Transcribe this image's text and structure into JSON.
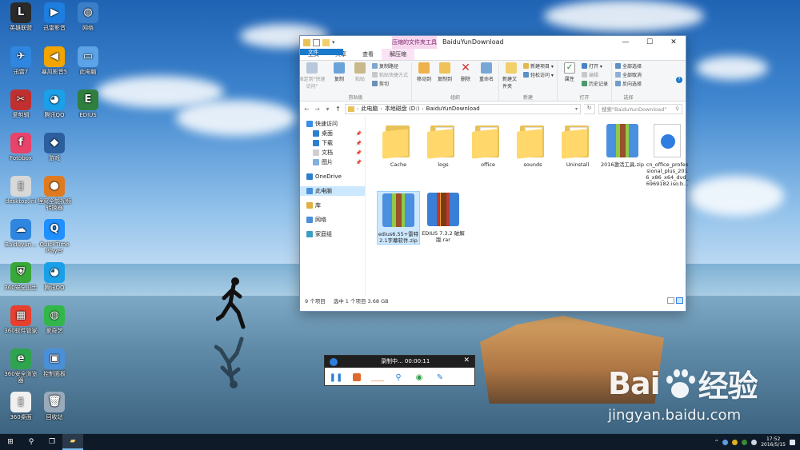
{
  "desktop": {
    "icons": [
      {
        "label": "英雄联盟",
        "color": "#2a2a2a",
        "glyph": "L"
      },
      {
        "label": "迅雷影音",
        "color": "#1d7ee0",
        "glyph": "▶"
      },
      {
        "label": "网络",
        "color": "#3a7fc8",
        "glyph": "◍"
      },
      {
        "label": "迅雷7",
        "color": "#2f86e0",
        "glyph": "✈"
      },
      {
        "label": "暴风影音5",
        "color": "#f2a500",
        "glyph": "◀"
      },
      {
        "label": "此电脑",
        "color": "#5ba3e6",
        "glyph": "▭"
      },
      {
        "label": "爱剪辑",
        "color": "#c03030",
        "glyph": "✂"
      },
      {
        "label": "腾讯QQ",
        "color": "#1aa0e8",
        "glyph": "◕"
      },
      {
        "label": "EDIUS",
        "color": "#2f7f3f",
        "glyph": "E"
      },
      {
        "label": "Fotobox",
        "color": "#e8436a",
        "glyph": "f"
      },
      {
        "label": "游戏",
        "color": "#2b5f9e",
        "glyph": "◆"
      },
      {
        "label": "desktop.ini",
        "color": "#d8d8d8",
        "glyph": "▯"
      },
      {
        "label": "狸窝全能视频转换器",
        "color": "#e07a20",
        "glyph": "●"
      },
      {
        "label": "Baiduyun...",
        "color": "#2f86e0",
        "glyph": "☁"
      },
      {
        "label": "QuickTime Player",
        "color": "#1e90ff",
        "glyph": "Q"
      },
      {
        "label": "360安全卫士",
        "color": "#38a838",
        "glyph": "⛨"
      },
      {
        "label": "腾讯QQ",
        "color": "#1aa0e8",
        "glyph": "◕"
      },
      {
        "label": "360软件管家",
        "color": "#e84030",
        "glyph": "▦"
      },
      {
        "label": "爱奇艺",
        "color": "#33b74a",
        "glyph": "◍"
      },
      {
        "label": "360安全浏览器",
        "color": "#2ea44f",
        "glyph": "e"
      },
      {
        "label": "控制面板",
        "color": "#4a90d9",
        "glyph": "▣"
      },
      {
        "label": "360桌面",
        "color": "#f0f0f0",
        "glyph": "▯"
      },
      {
        "label": "回收站",
        "color": "#9ab",
        "glyph": "🗑"
      }
    ]
  },
  "window": {
    "title": "BaiduYunDownload",
    "context_tab": "压缩的文件夹工具",
    "controls": {
      "minimize": "—",
      "maximize": "☐",
      "close": "✕"
    },
    "tabs": [
      "文件",
      "主页",
      "共享",
      "查看",
      "解压缩"
    ],
    "ribbon": {
      "clipboard": {
        "label": "剪贴板",
        "pin": "固定到\"快速访问\"",
        "copy": "复制",
        "paste": "粘贴",
        "small": [
          "复制路径",
          "粘贴快捷方式",
          "剪切"
        ]
      },
      "organize": {
        "label": "组织",
        "move_to": "移动到",
        "copy_to": "复制到",
        "delete": "删除",
        "rename": "重命名"
      },
      "new": {
        "label": "新建",
        "new_folder": "新建文件夹",
        "small": [
          "新建项目 ▾",
          "轻松访问 ▾"
        ]
      },
      "open": {
        "label": "打开",
        "properties": "属性",
        "small": [
          "打开 ▾",
          "编辑",
          "历史记录"
        ]
      },
      "select": {
        "label": "选择",
        "small": [
          "全部选择",
          "全部取消",
          "反向选择"
        ]
      },
      "help": "?"
    },
    "nav": {
      "back": "←",
      "forward": "→",
      "up": "↑",
      "recent": "▾",
      "refresh": "↻"
    },
    "address": [
      "此电脑",
      "本地磁盘 (D:)",
      "BaiduYunDownload"
    ],
    "search_placeholder": "搜索\"BaiduYunDownload\"",
    "navpane": [
      {
        "label": "快速访问",
        "type": "top",
        "color": "#3a8ee6"
      },
      {
        "label": "桌面",
        "type": "sub",
        "color": "#2f7fcf",
        "pin": "📌"
      },
      {
        "label": "下载",
        "type": "sub",
        "color": "#2f7fcf",
        "pin": "📌"
      },
      {
        "label": "文档",
        "type": "sub",
        "color": "#cfcfcf",
        "pin": "📌"
      },
      {
        "label": "图片",
        "type": "sub",
        "color": "#7fb0e0",
        "pin": "📌"
      },
      {
        "label": "OneDrive",
        "type": "top",
        "color": "#2f7fcf"
      },
      {
        "label": "此电脑",
        "type": "top",
        "color": "#4a90d9",
        "selected": true
      },
      {
        "label": "库",
        "type": "top",
        "color": "#e0b040"
      },
      {
        "label": "网络",
        "type": "top",
        "color": "#4a90d9"
      },
      {
        "label": "家庭组",
        "type": "top",
        "color": "#3aa0c0"
      }
    ],
    "files": [
      {
        "name": "Cache",
        "kind": "folder"
      },
      {
        "name": "logs",
        "kind": "folder-paper"
      },
      {
        "name": "office",
        "kind": "folder-paper"
      },
      {
        "name": "sounds",
        "kind": "folder-paper"
      },
      {
        "name": "Uninstall",
        "kind": "folder-paper"
      },
      {
        "name": "2016激活工具.zip",
        "kind": "zip"
      },
      {
        "name": "cn_office_professional_plus_2016_x86_x64_dvd_6969182.iso.b...",
        "kind": "iso"
      },
      {
        "name": "edius6.55+雷特2.1字幕软件.zip",
        "kind": "zip",
        "selected": true
      },
      {
        "name": "EDIUS 7.3.2 破解版.rar",
        "kind": "rar"
      }
    ],
    "status": {
      "count": "9 个项目",
      "selected": "选中 1 个项目  3.68 GB"
    }
  },
  "recorder": {
    "status": "录制中...  00:00:11",
    "close": "✕",
    "tools": [
      "pause",
      "stop",
      "line",
      "marker",
      "highlight",
      "pen"
    ]
  },
  "taskbar": {
    "start": "⊞",
    "search": "⚲",
    "taskview": "❐",
    "explorer": "▰",
    "time": "17:52",
    "date": "2016/5/15",
    "tray_caret": "^"
  },
  "watermark": {
    "logo_left": "Bai",
    "logo_right": "经验",
    "url": "jingyan.baidu.com"
  }
}
